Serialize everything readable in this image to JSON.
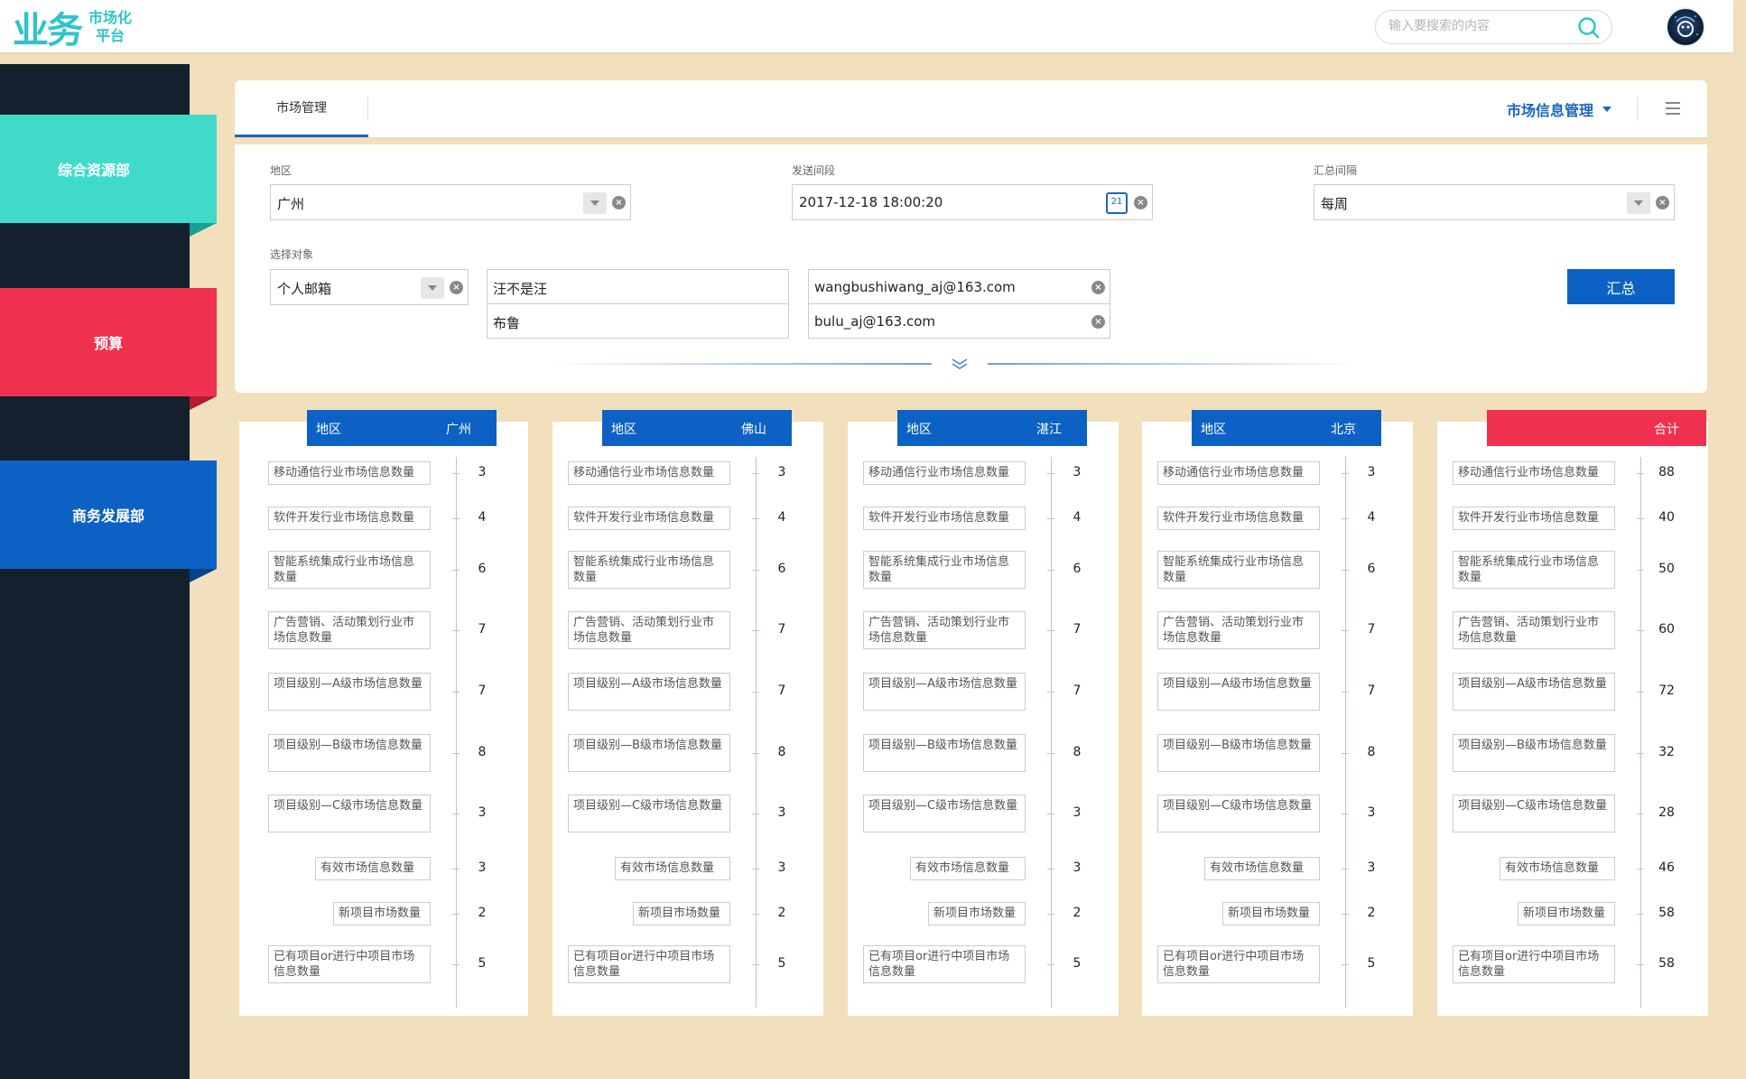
{
  "header": {
    "logo_mark": "业务",
    "logo_line1": "市场化",
    "logo_line2": "平台",
    "search_placeholder": "输入要搜索的内容"
  },
  "sidebar": {
    "items": [
      {
        "label": "综合资源部",
        "color": "#40dbc8"
      },
      {
        "label": "预算",
        "color": "#f0304f"
      },
      {
        "label": "商务发展部",
        "color": "#0c62c4"
      }
    ]
  },
  "tabs": {
    "active": "市场管理",
    "dropdown": "市场信息管理"
  },
  "filters": {
    "region_label": "地区",
    "region_value": "广州",
    "time_label": "发送间段",
    "time_value": "2017-12-18 18:00:20",
    "calendar_day": "21",
    "interval_label": "汇总间隔",
    "interval_value": "每周",
    "target_label": "选择对象",
    "target_type": "个人邮箱",
    "names": [
      "汪不是汪",
      "布鲁"
    ],
    "emails": [
      "wangbushiwang_aj@163.com",
      "bulu_aj@163.com"
    ],
    "summary_button": "汇总"
  },
  "metrics": [
    "移动通信行业市场信息数量",
    "软件开发行业市场信息数量",
    "智能系统集成行业市场信息数量",
    "广告营销、活动策划行业市场信息数量",
    "项目级别—A级市场信息数量",
    "项目级别—B级市场信息数量",
    "项目级别—C级市场信息数量",
    "有效市场信息数量",
    "新项目市场数量",
    "已有项目or进行中项目市场信息数量"
  ],
  "cards": [
    {
      "key": "地区",
      "city": "广州",
      "values": [
        "3",
        "4",
        "6",
        "7",
        "7",
        "8",
        "3",
        "3",
        "2",
        "5"
      ]
    },
    {
      "key": "地区",
      "city": "佛山",
      "values": [
        "3",
        "4",
        "6",
        "7",
        "7",
        "8",
        "3",
        "3",
        "2",
        "5"
      ]
    },
    {
      "key": "地区",
      "city": "湛江",
      "values": [
        "3",
        "4",
        "6",
        "7",
        "7",
        "8",
        "3",
        "3",
        "2",
        "5"
      ]
    },
    {
      "key": "地区",
      "city": "北京",
      "values": [
        "3",
        "4",
        "6",
        "7",
        "7",
        "8",
        "3",
        "3",
        "2",
        "5"
      ]
    }
  ],
  "total_card": {
    "label": "合计",
    "values": [
      "88",
      "40",
      "50",
      "60",
      "72",
      "32",
      "28",
      "46",
      "58",
      "58"
    ]
  },
  "colors": {
    "accent": "#0c62c4",
    "teal": "#40dbc8",
    "red": "#f0304f",
    "sidebar_bg": "#14202e",
    "page_bg": "#f2e0bd"
  }
}
